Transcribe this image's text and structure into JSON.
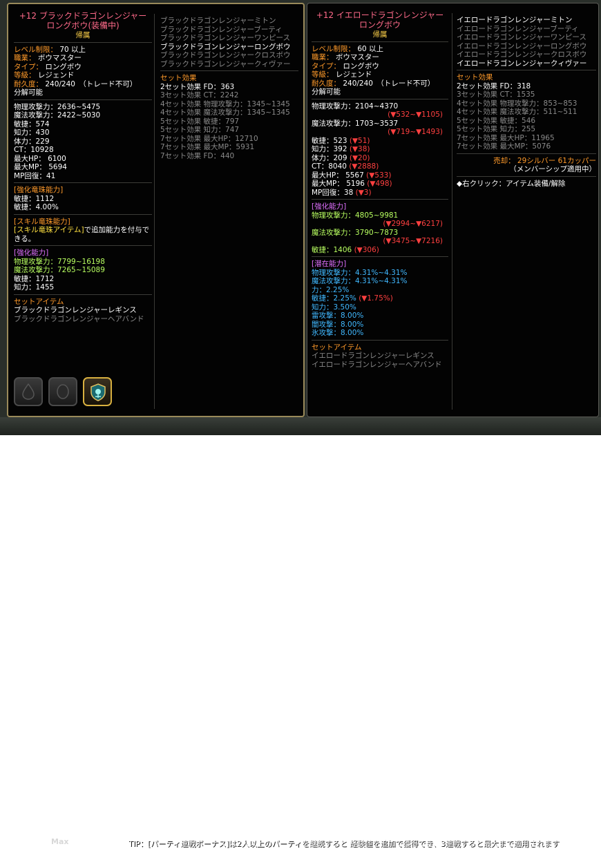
{
  "footer": {
    "max_label": "Max",
    "tip": "TIP：[パーティ連戦ボーナス]は2人以上のパーティを継続すると 経験値を追加で獲得でき、3連戦すると最大まで適用されます"
  },
  "item1": {
    "title_line1": "+12 ブラックドラゴンレンジャー",
    "title_line2": "ロングボウ(装備中)",
    "bound": "帰属",
    "info": [
      "レベル制限： 70 以上",
      "職業： ボウマスター",
      "タイプ： ロングボウ",
      "等級： レジェンド",
      "耐久度： 240/240　（トレード不可）",
      "分解可能"
    ],
    "stats": [
      "物理攻撃力：2636~5475",
      "魔法攻撃力：2422~5030",
      "敏捷：574",
      "知力：430",
      "体力：229",
      "CT：10928",
      "最大HP： 6100",
      "最大MP： 5694",
      "MP回復：41"
    ],
    "orb_header": "[強化竜珠能力]",
    "orb_stats": [
      "敏捷：1112",
      "敏捷：4.00%"
    ],
    "skill_orb_header": "[スキル竜珠能力]",
    "skill_orb_desc_highlight": "[スキル竜珠アイテム]",
    "skill_orb_desc_rest": "で追加能力を付与できる。",
    "enhance_header": "[強化能力]",
    "enhance_stats": [
      "物理攻撃力：7799~16198",
      "魔法攻撃力：7265~15089"
    ],
    "enhance_stats_white": [
      "敏捷：1712",
      "知力：1455"
    ],
    "set_item_header": "セットアイテム",
    "set_items_owned": [
      "ブラックドラゴンレンジャーレギンス"
    ],
    "set_items_missing": [
      "ブラックドラゴンレンジャーヘアバンド"
    ],
    "set_list_missing_a": [
      "ブラックドラゴンレンジャーミトン",
      "ブラックドラゴンレンジャーブーティ",
      "ブラックドラゴンレンジャーワンピース"
    ],
    "set_list_owned": [
      "ブラックドラゴンレンジャーロングボウ"
    ],
    "set_list_missing_b": [
      "ブラックドラゴンレンジャークロスボウ",
      "ブラックドラゴンレンジャークィヴァー"
    ],
    "set_effect_header": "セット効果",
    "set_effect_active": [
      "2セット効果 FD：363"
    ],
    "set_effect_inactive": [
      "3セット効果 CT：2242",
      "4セット効果 物理攻撃力：1345~1345",
      "4セット効果 魔法攻撃力：1345~1345",
      "5セット効果 敏捷：797",
      "5セット効果 知力：747",
      "7セット効果 最大HP：12710",
      "7セット効果 最大MP：5931",
      "7セット効果 FD：440"
    ]
  },
  "item2": {
    "title_line1": "+12 イエロードラゴンレンジャー",
    "title_line2": "ロングボウ",
    "bound": "帰属",
    "info": [
      "レベル制限： 60 以上",
      "職業： ボウマスター",
      "タイプ： ロングボウ",
      "等級： レジェンド",
      "耐久度： 240/240　（トレード不可）",
      "分解可能"
    ],
    "attack": [
      {
        "label": "物理攻撃力：2104~4370",
        "diff": "(▼532~▼1105)"
      },
      {
        "label": "魔法攻撃力：1703~3537",
        "diff": "(▼719~▼1493)"
      }
    ],
    "stats": [
      {
        "label": "敏捷：523",
        "diff": "(▼51)"
      },
      {
        "label": "知力：392",
        "diff": "(▼38)"
      },
      {
        "label": "体力：209",
        "diff": "(▼20)"
      },
      {
        "label": "CT：8040",
        "diff": "(▼2888)"
      },
      {
        "label": "最大HP： 5567",
        "diff": "(▼533)"
      },
      {
        "label": "最大MP： 5196",
        "diff": "(▼498)"
      },
      {
        "label": "MP回復：38",
        "diff": "(▼3)"
      }
    ],
    "enhance_header": "[強化能力]",
    "enhance_attack": [
      {
        "label": "物理攻撃力：4805~9981",
        "diff": "(▼2994~▼6217)"
      },
      {
        "label": "魔法攻撃力：3790~7873",
        "diff": "(▼3475~▼7216)"
      }
    ],
    "enhance_agi": {
      "label": "敏捷：1406",
      "diff": "(▼306)"
    },
    "potential_header": "[潜在能力]",
    "potential_a": [
      "物理攻撃力：4.31%~4.31%",
      "魔法攻撃力：4.31%~4.31%",
      "力：2.25%"
    ],
    "potential_agi": {
      "label": "敏捷：2.25%",
      "diff": "(▼1.75%)"
    },
    "potential_b": [
      "知力：3.50%",
      "雷攻撃：8.00%",
      "闇攻撃：8.00%",
      "氷攻撃：8.00%"
    ],
    "set_item_header": "セットアイテム",
    "set_items_missing": [
      "イエロードラゴンレンジャーレギンス",
      "イエロードラゴンレンジャーヘアバンド"
    ],
    "set_list_owned_a": [
      "イエロードラゴンレンジャーミトン"
    ],
    "set_list_missing": [
      "イエロードラゴンレンジャーブーティ",
      "イエロードラゴンレンジャーワンピース",
      "イエロードラゴンレンジャーロングボウ",
      "イエロードラゴンレンジャークロスボウ"
    ],
    "set_list_owned_b": [
      "イエロードラゴンレンジャークィヴァー"
    ],
    "set_effect_header": "セット効果",
    "set_effect_active": [
      "2セット効果 FD：318"
    ],
    "set_effect_inactive": [
      "3セット効果 CT：1535",
      "4セット効果 物理攻撃力：853~853",
      "4セット効果 魔法攻撃力：511~511",
      "5セット効果 敏捷：546",
      "5セット効果 知力：255",
      "7セット効果 最大HP：11965",
      "7セット効果 最大MP：5076"
    ],
    "sell_price": "売却： 29シルバー 61カッパー",
    "membership_note": "（メンバーシップ適用中）",
    "right_click_note": "◆右クリック：アイテム装備/解除"
  }
}
